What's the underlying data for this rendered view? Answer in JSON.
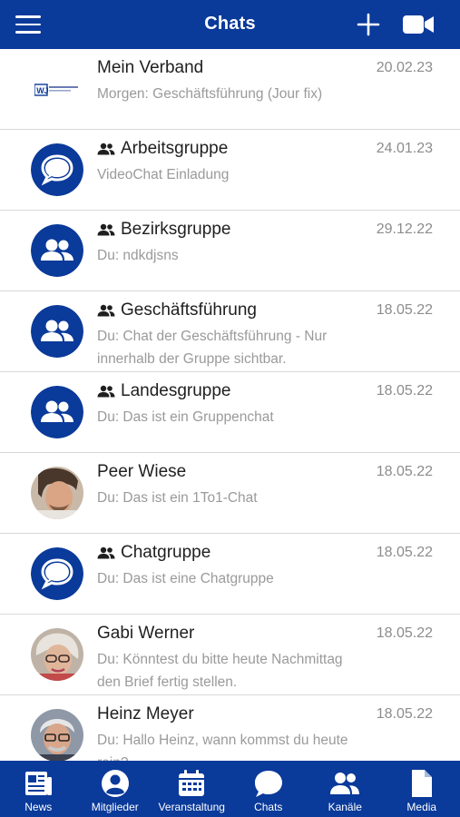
{
  "header": {
    "title": "Chats",
    "menu_icon": "hamburger-menu-icon",
    "add_icon": "plus-icon",
    "video_icon": "video-camera-icon"
  },
  "chats": [
    {
      "name": "Mein Verband",
      "date": "20.02.23",
      "preview": "Morgen: Geschäftsführung (Jour fix)",
      "group": false,
      "avatar": "logo",
      "logo_text": "WJ"
    },
    {
      "name": "Arbeitsgruppe",
      "date": "24.01.23",
      "preview": "VideoChat Einladung",
      "group": true,
      "avatar": "chat-bubble-icon"
    },
    {
      "name": "Bezirksgruppe",
      "date": "29.12.22",
      "preview": "Du: ndkdjsns",
      "group": true,
      "avatar": "people-icon"
    },
    {
      "name": "Geschäftsführung",
      "date": "18.05.22",
      "preview": "Du: Chat der Geschäftsführung - Nur innerhalb der Gruppe sichtbar.",
      "group": true,
      "avatar": "people-icon"
    },
    {
      "name": "Landesgruppe",
      "date": "18.05.22",
      "preview": "Du: Das ist ein Gruppenchat",
      "group": true,
      "avatar": "people-icon"
    },
    {
      "name": "Peer Wiese",
      "date": "18.05.22",
      "preview": "Du: Das ist ein 1To1-Chat",
      "group": false,
      "avatar": "photo-peer"
    },
    {
      "name": "Chatgruppe",
      "date": "18.05.22",
      "preview": "Du: Das ist eine Chatgruppe",
      "group": true,
      "avatar": "chat-bubble-icon"
    },
    {
      "name": "Gabi Werner",
      "date": "18.05.22",
      "preview": "Du: Könntest du bitte heute Nachmittag den Brief fertig stellen.",
      "group": false,
      "avatar": "photo-gabi"
    },
    {
      "name": "Heinz Meyer",
      "date": "18.05.22",
      "preview": "Du: Hallo Heinz, wann kommst du heute rein?",
      "group": false,
      "avatar": "photo-heinz"
    }
  ],
  "tabs": [
    {
      "label": "News",
      "icon": "newspaper-icon"
    },
    {
      "label": "Mitglieder",
      "icon": "user-circle-icon"
    },
    {
      "label": "Veranstaltung",
      "icon": "calendar-icon"
    },
    {
      "label": "Chats",
      "icon": "chat-bubble-icon",
      "active": true
    },
    {
      "label": "Kanäle",
      "icon": "people-icon"
    },
    {
      "label": "Media",
      "icon": "document-icon"
    }
  ],
  "colors": {
    "brand": "#0a3a9a",
    "text": "#1f1f1f",
    "muted": "#9a9a9a",
    "divider": "#d9d9d9"
  }
}
